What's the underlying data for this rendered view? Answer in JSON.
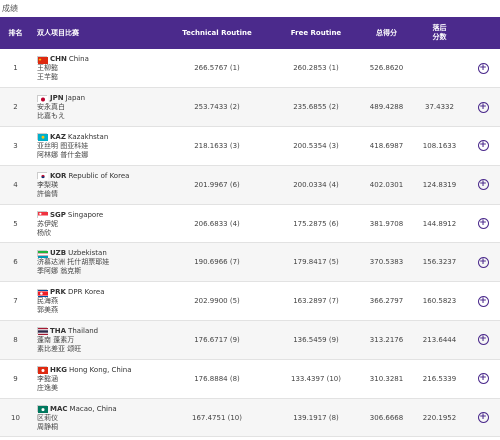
{
  "page_title": "成绩",
  "headers": {
    "rank": "排名",
    "team": "双人项目比赛",
    "technical": "Technical Routine",
    "free": "Free Routine",
    "total": "总得分",
    "behind": "落后\n分数"
  },
  "colors": {
    "header_bg": "#4b2a8c",
    "accent": "#4b2a8c"
  },
  "rows": [
    {
      "rank": "1",
      "flag": "china",
      "code": "CHN",
      "country": "China",
      "athletes": [
        "王柳懿",
        "王芊懿"
      ],
      "technical": "266.5767 (1)",
      "free": "260.2853 (1)",
      "total": "526.8620",
      "behind": ""
    },
    {
      "rank": "2",
      "flag": "japan",
      "code": "JPN",
      "country": "Japan",
      "athletes": [
        "安永真白",
        "比嘉もえ"
      ],
      "technical": "253.7433 (2)",
      "free": "235.6855 (2)",
      "total": "489.4288",
      "behind": "37.4332"
    },
    {
      "rank": "3",
      "flag": "kazakhstan",
      "code": "KAZ",
      "country": "Kazakhstan",
      "athletes": [
        "亚丝明 图亚科娃",
        "阿林娜 普什金娜"
      ],
      "technical": "218.1633 (3)",
      "free": "200.5354 (3)",
      "total": "418.6987",
      "behind": "108.1633"
    },
    {
      "rank": "4",
      "flag": "korea",
      "code": "KOR",
      "country": "Republic of Korea",
      "athletes": [
        "李梨瑛",
        "許倫情"
      ],
      "technical": "201.9967 (6)",
      "free": "200.0334 (4)",
      "total": "402.0301",
      "behind": "124.8319"
    },
    {
      "rank": "5",
      "flag": "singapore",
      "code": "SGP",
      "country": "Singapore",
      "athletes": [
        "苏伊妮",
        "杨欣"
      ],
      "technical": "206.6833 (4)",
      "free": "175.2875 (6)",
      "total": "381.9708",
      "behind": "144.8912"
    },
    {
      "rank": "6",
      "flag": "uzbekistan",
      "code": "UZB",
      "country": "Uzbekistan",
      "athletes": [
        "济慕达洲 托什胡票耶娃",
        "季阿娜 翁克斯"
      ],
      "technical": "190.6966 (7)",
      "free": "179.8417 (5)",
      "total": "370.5383",
      "behind": "156.3237"
    },
    {
      "rank": "7",
      "flag": "prk",
      "code": "PRK",
      "country": "DPR Korea",
      "athletes": [
        "民海燕",
        "郭美燕"
      ],
      "technical": "202.9900 (5)",
      "free": "163.2897 (7)",
      "total": "366.2797",
      "behind": "160.5823"
    },
    {
      "rank": "8",
      "flag": "thailand",
      "code": "THA",
      "country": "Thailand",
      "athletes": [
        "蓬南 蓬素万",
        "素比差亚 颂旺"
      ],
      "technical": "176.6717 (9)",
      "free": "136.5459 (9)",
      "total": "313.2176",
      "behind": "213.6444"
    },
    {
      "rank": "9",
      "flag": "hongkong",
      "code": "HKG",
      "country": "Hong Kong, China",
      "athletes": [
        "李懿涵",
        "庄逸美"
      ],
      "technical": "176.8884 (8)",
      "free": "133.4397 (10)",
      "total": "310.3281",
      "behind": "216.5339"
    },
    {
      "rank": "10",
      "flag": "macao",
      "code": "MAC",
      "country": "Macao, China",
      "athletes": [
        "区莉仪",
        "周静桐"
      ],
      "technical": "167.4751 (10)",
      "free": "139.1917 (8)",
      "total": "306.6668",
      "behind": "220.1952"
    }
  ]
}
